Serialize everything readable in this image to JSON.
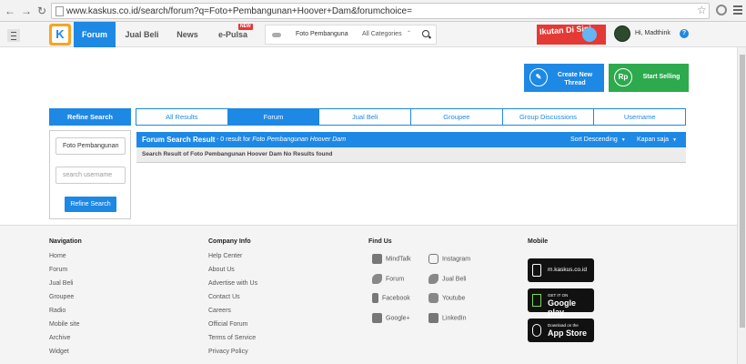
{
  "browser": {
    "url": "www.kaskus.co.id/search/forum?q=Foto+Pembangunan+Hoover+Dam&forumchoice="
  },
  "header": {
    "logo_letter": "K",
    "nav": [
      "Forum",
      "Jual Beli",
      "News",
      "e-Pulsa"
    ],
    "new_badge": "NEW",
    "search_query": "Foto Pembanguna",
    "search_category": "All Categories",
    "promo_text": "Ikutan Di Sini",
    "greeting": "Hi, Madthink",
    "help": "?"
  },
  "actions": {
    "create_thread": "Create New Thread",
    "start_selling": "Start Selling",
    "rp_icon": "Rp"
  },
  "refine": {
    "title": "Refine Search",
    "query_value": "Foto Pembangunan",
    "username_placeholder": "search username",
    "button": "Refine Search"
  },
  "tabs": [
    "All Results",
    "Forum",
    "Jual Beli",
    "Groupee",
    "Group Discussions",
    "Username"
  ],
  "active_tab": "Forum",
  "results": {
    "title": "Forum Search Result",
    "subtitle_prefix": " - 0 result for ",
    "query_italic": "Foto Pembangunan Hoover Dam",
    "sort": "Sort Descending",
    "time": "Kapan saja",
    "empty_message": "Search Result of Foto Pembangunan Hoover Dam No Results found"
  },
  "footer": {
    "navigation": {
      "heading": "Navigation",
      "items": [
        "Home",
        "Forum",
        "Jual Beli",
        "Groupee",
        "Radio",
        "Mobile site",
        "Archive",
        "Widget"
      ]
    },
    "company": {
      "heading": "Company Info",
      "items": [
        "Help Center",
        "About Us",
        "Advertise with Us",
        "Contact Us",
        "Careers",
        "Official Forum",
        "Terms of Service",
        "Privacy Policy"
      ]
    },
    "findus": {
      "heading": "Find Us",
      "left": [
        "MindTalk",
        "Forum",
        "Facebook",
        "Google+"
      ],
      "right": [
        "Instagram",
        "Jual Beli",
        "Youtube",
        "LinkedIn"
      ]
    },
    "mobile": {
      "heading": "Mobile",
      "site": "m.kaskus.co.id",
      "gp_small": "GET IT ON",
      "gp_big": "Google play",
      "as_small": "Download on the",
      "as_big": "App Store"
    }
  }
}
